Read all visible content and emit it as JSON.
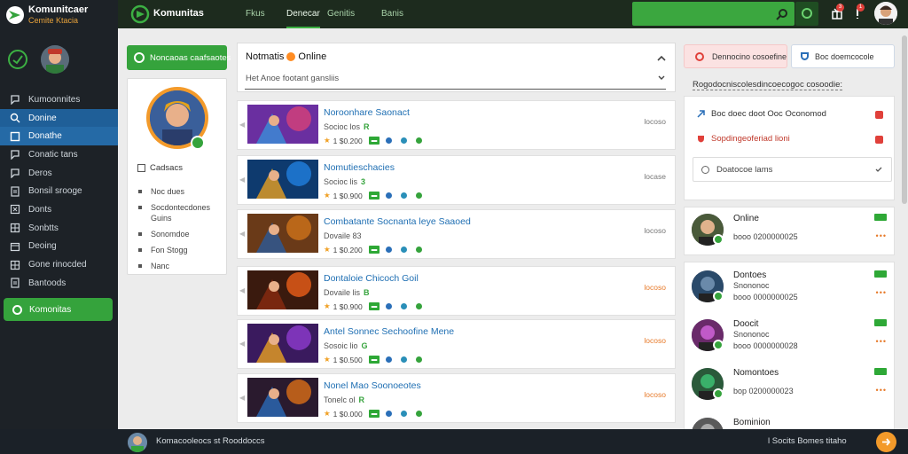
{
  "app": {
    "brand_title": "Komunitcaer",
    "brand_subtitle": "Cemite Ktacia",
    "top_title": "Komunitas"
  },
  "topbar": {
    "tabs": [
      {
        "label": "Fkus",
        "active": false
      },
      {
        "label": "Denecar",
        "active": true
      },
      {
        "label": "Genitis",
        "active": false
      },
      {
        "label": "Banis",
        "active": false
      }
    ],
    "notif_count_1": "3",
    "notif_count_2": "1"
  },
  "sidebar": {
    "items": [
      {
        "label": "Kumoonnites",
        "icon": "chat-icon",
        "state": ""
      },
      {
        "label": "Donine",
        "icon": "search-icon",
        "state": "active"
      },
      {
        "label": "Donathe",
        "icon": "square-icon",
        "state": "active2"
      },
      {
        "label": "Conatic tans",
        "icon": "chat-icon",
        "state": ""
      },
      {
        "label": "Deros",
        "icon": "chat-icon",
        "state": ""
      },
      {
        "label": "Bonsil srooge",
        "icon": "doc-icon",
        "state": ""
      },
      {
        "label": "Donts",
        "icon": "x-box-icon",
        "state": ""
      },
      {
        "label": "Sonbtts",
        "icon": "grid-icon",
        "state": ""
      },
      {
        "label": "Deoing",
        "icon": "calendar-icon",
        "state": ""
      },
      {
        "label": "Gone rinocded",
        "icon": "grid-icon",
        "state": ""
      },
      {
        "label": "Bantoods",
        "icon": "doc-icon",
        "state": ""
      }
    ],
    "cta_label": "Komonitas"
  },
  "profile": {
    "button_label": "Noncaoas caafsaotes",
    "section_label": "Cadsacs",
    "items": [
      "Noc dues",
      "Socdontecdones Guins",
      "Sonomdoe",
      "Fon Stogg",
      "Nanc"
    ]
  },
  "feed": {
    "title_left": "Notmatis",
    "title_right": "Online",
    "subtitle": "Het Anoe footant gansliis",
    "posts": [
      {
        "title": "Noroonhare Saonact",
        "meta": "Socioc los",
        "meta_tag": "R",
        "stats": "1 $0.200",
        "time": "locoso",
        "time_orange": false
      },
      {
        "title": "Nomutieschacies",
        "meta": "Socioc lis",
        "meta_tag": "3",
        "stats": "1 $0.900",
        "time": "locase",
        "time_orange": false
      },
      {
        "title": "Combatante Socnanta leye Saaoed",
        "meta": "Dovaile  83",
        "meta_tag": "",
        "stats": "1 $0.200",
        "time": "locoso",
        "time_orange": false
      },
      {
        "title": "Dontaloie Chicoch Goil",
        "meta": "Dovaile lis",
        "meta_tag": "B",
        "stats": "1 $0.900",
        "time": "locoso",
        "time_orange": true
      },
      {
        "title": "Antel Sonnec Sechoofine Mene",
        "meta": "Sosoic lio",
        "meta_tag": "G",
        "stats": "1 $0.500",
        "time": "locoso",
        "time_orange": true
      },
      {
        "title": "Nonel Mao Soonoeotes",
        "meta": "Tonelc ol",
        "meta_tag": "R",
        "stats": "1 $0.000",
        "time": "locoso",
        "time_orange": true
      }
    ]
  },
  "rightpanel": {
    "btn1_label": "Dennocino cosoefine",
    "btn2_label": "Boc doemcocole",
    "label": "Rogodocniscolesdincoecogoc cosoodie:",
    "row1": "Boc doec doot Ooc Oconomod",
    "row2": "Sopdingeoferiad lioni",
    "select_label": "Doatocoe lams",
    "friends": [
      {
        "name": "Online",
        "status": "booo 0200000025"
      },
      {
        "name": "Dontoes",
        "status": "Snononoc"
      },
      {
        "name": "Doocit",
        "status": "Snononoc"
      },
      {
        "name": "Nomontoes",
        "status": "bop 0200000023"
      },
      {
        "name": "Bominion",
        "status": ""
      }
    ],
    "friend_status_2": "booo 0000000025",
    "friend_status_3": "booo 0000000028"
  },
  "bottombar": {
    "left_text": "Komacooleocs  st Rooddoccs",
    "right_text": "l  Socits  Bomes  titaho"
  },
  "colors": {
    "accent_green": "#35a33c",
    "nav_blue": "#1f5f98",
    "orange": "#f39a2a",
    "link_blue": "#1f6fb3"
  }
}
